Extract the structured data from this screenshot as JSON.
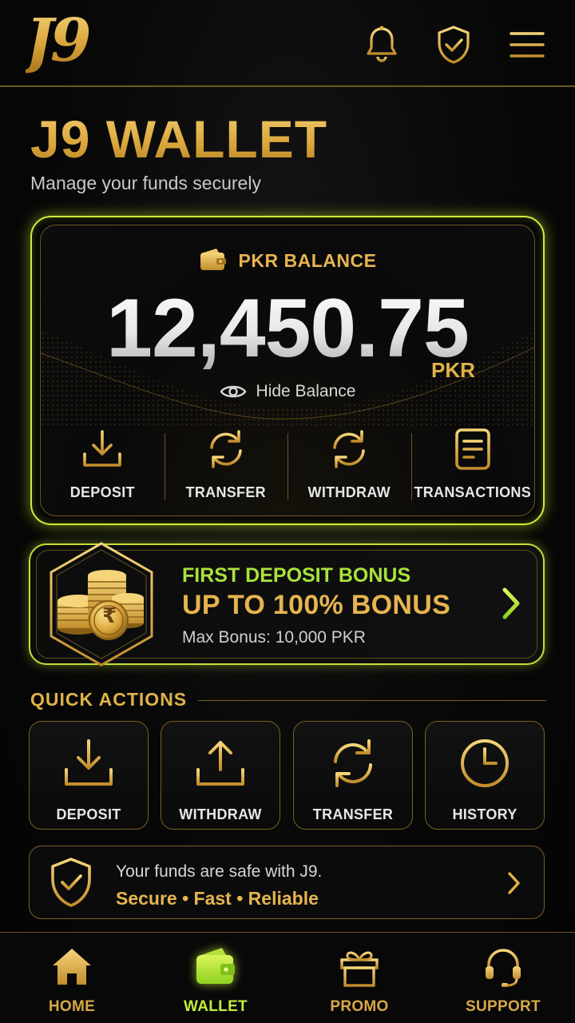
{
  "header": {
    "logo_text": "J9",
    "icons": [
      "bell-icon",
      "shield-check-icon",
      "menu-icon"
    ]
  },
  "page": {
    "title": "J9 WALLET",
    "subtitle": "Manage your funds securely"
  },
  "balance": {
    "label": "PKR BALANCE",
    "amount": "12,450.75",
    "currency": "PKR",
    "hide_label": "Hide Balance",
    "actions": [
      {
        "label": "DEPOSIT",
        "icon": "download-icon"
      },
      {
        "label": "TRANSFER",
        "icon": "refresh-icon"
      },
      {
        "label": "WITHDRAW",
        "icon": "refresh-icon"
      },
      {
        "label": "TRANSACTIONS",
        "icon": "document-icon"
      }
    ]
  },
  "bonus": {
    "title": "FIRST DEPOSIT BONUS",
    "headline": "UP TO 100% BONUS",
    "detail": "Max Bonus: 10,000 PKR",
    "coin_symbol": "₹"
  },
  "quick_actions": {
    "title": "QUICK ACTIONS",
    "items": [
      {
        "label": "DEPOSIT",
        "icon": "download-icon"
      },
      {
        "label": "WITHDRAW",
        "icon": "upload-icon"
      },
      {
        "label": "TRANSFER",
        "icon": "refresh-icon"
      },
      {
        "label": "HISTORY",
        "icon": "clock-icon"
      }
    ]
  },
  "safety": {
    "line1": "Your funds are safe with J9.",
    "line2": "Secure • Fast • Reliable"
  },
  "nav": {
    "items": [
      {
        "label": "HOME",
        "icon": "home-icon"
      },
      {
        "label": "WALLET",
        "icon": "wallet-icon",
        "active": true
      },
      {
        "label": "PROMO",
        "icon": "gift-icon"
      },
      {
        "label": "SUPPORT",
        "icon": "headset-icon"
      }
    ]
  },
  "colors": {
    "gold": "#e0b24a",
    "neon_green": "#c4ee3a",
    "background": "#050505"
  }
}
